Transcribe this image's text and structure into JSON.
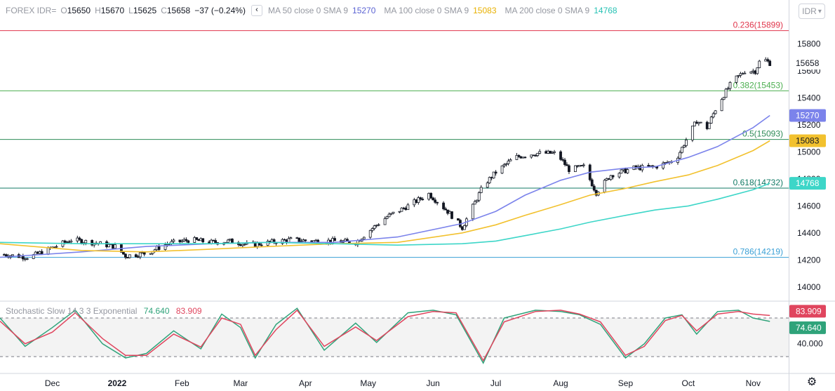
{
  "legend": {
    "symbol": "FOREX IDR=",
    "o_label": "O",
    "o": "15650",
    "h_label": "H",
    "h": "15670",
    "l_label": "L",
    "l": "15625",
    "c_label": "C",
    "c": "15658",
    "change": "−37 (−0.24%)",
    "ma50_title": "MA 50 close 0 SMA 9",
    "ma50_value": "15270",
    "ma100_title": "MA 100 close 0 SMA 9",
    "ma100_value": "15083",
    "ma200_title": "MA 200 close 0 SMA 9",
    "ma200_value": "14768"
  },
  "currency_select": "IDR",
  "stochastic": {
    "title": "Stochastic Slow 14 3 3 Exponential",
    "k_value": "74.640",
    "d_value": "83.909",
    "axis_label": "40.000"
  },
  "colors": {
    "up": "#ffffff",
    "down": "#131722",
    "candle_outline": "#131722",
    "ma50": "#7b83eb",
    "ma100": "#f2c12e",
    "ma200": "#3dd6c8",
    "fib_0236": "#e0354b",
    "fib_0382": "#4caf50",
    "fib_05": "#2e8b57",
    "fib_0618": "#117a65",
    "fib_0786": "#3aa0d6",
    "stoch_k": "#2fa37a",
    "stoch_d": "#e0455e",
    "price_label": "#131722"
  },
  "chart_data": [
    {
      "type": "candlestick",
      "title": "",
      "y_ticks": [
        14000,
        14200,
        14400,
        14600,
        14800,
        15000,
        15200,
        15400,
        15600,
        15800
      ],
      "ylim": [
        13900,
        15980
      ],
      "x_labels": [
        {
          "label": "Dec",
          "date": "2021-12-01"
        },
        {
          "label": "2022",
          "date": "2022-01-01"
        },
        {
          "label": "Feb",
          "date": "2022-02-01"
        },
        {
          "label": "Mar",
          "date": "2022-03-01"
        },
        {
          "label": "Apr",
          "date": "2022-04-01"
        },
        {
          "label": "May",
          "date": "2022-05-01"
        },
        {
          "label": "Jun",
          "date": "2022-06-01"
        },
        {
          "label": "Jul",
          "date": "2022-07-01"
        },
        {
          "label": "Aug",
          "date": "2022-08-01"
        },
        {
          "label": "Sep",
          "date": "2022-09-01"
        },
        {
          "label": "Oct",
          "date": "2022-10-01"
        },
        {
          "label": "Nov",
          "date": "2022-11-01"
        }
      ],
      "xlim": [
        "2021-11-06",
        "2022-11-18"
      ],
      "last_price": {
        "value": 15658,
        "label": "15658"
      },
      "fib_levels": [
        {
          "ratio": "0.236",
          "value": 15899,
          "label": "0.236(15899)"
        },
        {
          "ratio": "0.382",
          "value": 15453,
          "label": "0.382(15453)"
        },
        {
          "ratio": "0.5",
          "value": 15093,
          "label": "0.5(15093)"
        },
        {
          "ratio": "0.618",
          "value": 14732,
          "label": "0.618(14732)"
        },
        {
          "ratio": "0.786",
          "value": 14219,
          "label": "0.786(14219)"
        }
      ],
      "close_path": [
        [
          "2021-11-08",
          14240
        ],
        [
          "2021-11-20",
          14220
        ],
        [
          "2021-12-01",
          14290
        ],
        [
          "2021-12-10",
          14350
        ],
        [
          "2021-12-20",
          14330
        ],
        [
          "2021-12-31",
          14300
        ],
        [
          "2022-01-05",
          14230
        ],
        [
          "2022-01-15",
          14250
        ],
        [
          "2022-01-25",
          14320
        ],
        [
          "2022-02-05",
          14350
        ],
        [
          "2022-02-15",
          14330
        ],
        [
          "2022-02-25",
          14340
        ],
        [
          "2022-03-05",
          14310
        ],
        [
          "2022-03-15",
          14330
        ],
        [
          "2022-03-25",
          14350
        ],
        [
          "2022-04-05",
          14340
        ],
        [
          "2022-04-15",
          14340
        ],
        [
          "2022-04-25",
          14330
        ],
        [
          "2022-05-01",
          14410
        ],
        [
          "2022-05-10",
          14520
        ],
        [
          "2022-05-20",
          14600
        ],
        [
          "2022-05-30",
          14690
        ],
        [
          "2022-06-08",
          14560
        ],
        [
          "2022-06-15",
          14440
        ],
        [
          "2022-06-25",
          14750
        ],
        [
          "2022-07-01",
          14850
        ],
        [
          "2022-07-10",
          14960
        ],
        [
          "2022-07-20",
          14990
        ],
        [
          "2022-07-30",
          14990
        ],
        [
          "2022-08-05",
          14870
        ],
        [
          "2022-08-12",
          14890
        ],
        [
          "2022-08-18",
          14700
        ],
        [
          "2022-08-25",
          14830
        ],
        [
          "2022-09-05",
          14880
        ],
        [
          "2022-09-15",
          14890
        ],
        [
          "2022-09-25",
          14940
        ],
        [
          "2022-10-01",
          15120
        ],
        [
          "2022-10-05",
          15230
        ],
        [
          "2022-10-10",
          15180
        ],
        [
          "2022-10-15",
          15350
        ],
        [
          "2022-10-22",
          15520
        ],
        [
          "2022-10-28",
          15600
        ],
        [
          "2022-11-02",
          15600
        ],
        [
          "2022-11-05",
          15700
        ],
        [
          "2022-11-09",
          15658
        ]
      ],
      "series": [
        {
          "name": "MA 50 close 0 SMA 9",
          "x": [
            "2021-11-06",
            "2021-12-15",
            "2022-01-15",
            "2022-02-15",
            "2022-03-15",
            "2022-04-15",
            "2022-05-15",
            "2022-06-15",
            "2022-07-01",
            "2022-07-15",
            "2022-08-01",
            "2022-08-15",
            "2022-09-01",
            "2022-09-15",
            "2022-10-01",
            "2022-10-15",
            "2022-11-01",
            "2022-11-09"
          ],
          "y": [
            14220,
            14260,
            14300,
            14320,
            14330,
            14330,
            14370,
            14470,
            14560,
            14680,
            14790,
            14850,
            14880,
            14890,
            14960,
            15040,
            15180,
            15270
          ]
        },
        {
          "name": "MA 100 close 0 SMA 9",
          "x": [
            "2021-11-06",
            "2021-12-15",
            "2022-01-15",
            "2022-02-15",
            "2022-03-15",
            "2022-04-15",
            "2022-05-15",
            "2022-06-15",
            "2022-07-01",
            "2022-07-15",
            "2022-08-01",
            "2022-08-15",
            "2022-09-01",
            "2022-09-15",
            "2022-10-01",
            "2022-10-15",
            "2022-11-01",
            "2022-11-09"
          ],
          "y": [
            14320,
            14270,
            14260,
            14280,
            14300,
            14320,
            14330,
            14400,
            14460,
            14530,
            14610,
            14680,
            14730,
            14780,
            14830,
            14900,
            15010,
            15083
          ]
        },
        {
          "name": "MA 200 close 0 SMA 9",
          "x": [
            "2021-11-06",
            "2021-12-15",
            "2022-01-15",
            "2022-02-15",
            "2022-03-15",
            "2022-04-15",
            "2022-05-15",
            "2022-06-15",
            "2022-07-01",
            "2022-07-15",
            "2022-08-01",
            "2022-08-15",
            "2022-09-01",
            "2022-09-15",
            "2022-10-01",
            "2022-10-15",
            "2022-11-01",
            "2022-11-09"
          ],
          "y": [
            14330,
            14320,
            14320,
            14320,
            14330,
            14320,
            14310,
            14320,
            14340,
            14380,
            14430,
            14480,
            14530,
            14570,
            14600,
            14650,
            14720,
            14768
          ]
        }
      ]
    },
    {
      "type": "line",
      "title": "Stochastic Slow 14 3 3 Exponential",
      "ylim": [
        -5,
        105
      ],
      "y_ticks_labeled": [
        40
      ],
      "band": [
        20,
        80
      ],
      "series": [
        {
          "name": "%K",
          "x": [
            "2021-11-06",
            "2021-11-18",
            "2021-12-01",
            "2021-12-12",
            "2021-12-25",
            "2022-01-05",
            "2022-01-15",
            "2022-01-28",
            "2022-02-10",
            "2022-02-20",
            "2022-03-01",
            "2022-03-08",
            "2022-03-18",
            "2022-03-28",
            "2022-04-10",
            "2022-04-25",
            "2022-05-05",
            "2022-05-20",
            "2022-06-01",
            "2022-06-12",
            "2022-06-25",
            "2022-07-05",
            "2022-07-20",
            "2022-08-01",
            "2022-08-10",
            "2022-08-20",
            "2022-09-01",
            "2022-09-10",
            "2022-09-20",
            "2022-09-28",
            "2022-10-05",
            "2022-10-15",
            "2022-10-25",
            "2022-11-01",
            "2022-11-09"
          ],
          "y": [
            80,
            36,
            65,
            92,
            40,
            18,
            25,
            60,
            32,
            86,
            65,
            18,
            70,
            95,
            30,
            72,
            42,
            88,
            92,
            85,
            10,
            80,
            92,
            90,
            85,
            70,
            18,
            40,
            80,
            85,
            55,
            90,
            92,
            80,
            74.64
          ]
        },
        {
          "name": "%D",
          "x": [
            "2021-11-06",
            "2021-11-18",
            "2021-12-01",
            "2021-12-12",
            "2021-12-25",
            "2022-01-05",
            "2022-01-15",
            "2022-01-28",
            "2022-02-10",
            "2022-02-20",
            "2022-03-01",
            "2022-03-08",
            "2022-03-18",
            "2022-03-28",
            "2022-04-10",
            "2022-04-25",
            "2022-05-05",
            "2022-05-20",
            "2022-06-01",
            "2022-06-12",
            "2022-06-25",
            "2022-07-05",
            "2022-07-20",
            "2022-08-01",
            "2022-08-10",
            "2022-08-20",
            "2022-09-01",
            "2022-09-10",
            "2022-09-20",
            "2022-09-28",
            "2022-10-05",
            "2022-10-15",
            "2022-10-25",
            "2022-11-01",
            "2022-11-09"
          ],
          "y": [
            75,
            40,
            58,
            88,
            48,
            22,
            22,
            55,
            35,
            80,
            70,
            22,
            62,
            92,
            36,
            66,
            45,
            82,
            90,
            88,
            14,
            74,
            90,
            92,
            86,
            74,
            22,
            36,
            76,
            84,
            60,
            86,
            90,
            86,
            83.909
          ]
        }
      ]
    }
  ]
}
